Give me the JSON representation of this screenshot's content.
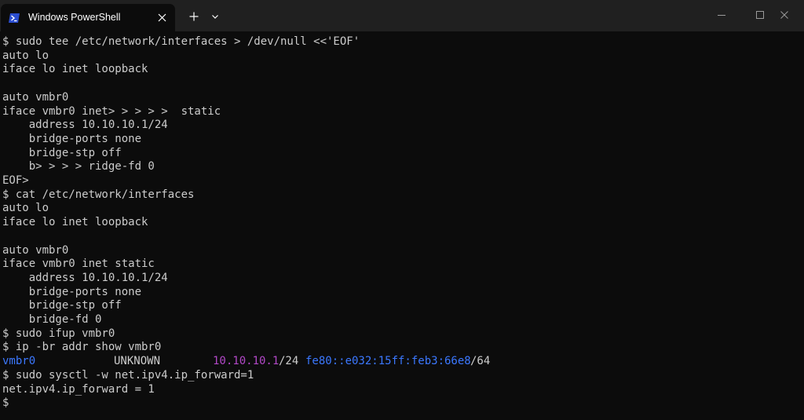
{
  "window": {
    "tab_title": "Windows PowerShell",
    "icons": {
      "tab": "powershell-icon",
      "close_tab": "close-icon",
      "new_tab": "plus-icon",
      "dropdown": "chevron-down-icon",
      "minimize": "minimize-icon",
      "maximize": "maximize-icon",
      "close_window": "close-icon"
    }
  },
  "colors": {
    "background": "#0c0c0c",
    "foreground": "#cccccc",
    "titlebar": "#202020",
    "blue": "#3b78ff",
    "magenta": "#b148c6"
  },
  "terminal": {
    "lines": [
      "$ sudo tee /etc/network/interfaces > /dev/null <<'EOF'",
      "auto lo",
      "iface lo inet loopback",
      "",
      "auto vmbr0",
      "iface vmbr0 inet> > > > >  static",
      "    address 10.10.10.1/24",
      "    bridge-ports none",
      "    bridge-stp off",
      "    b> > > > ridge-fd 0",
      "EOF>",
      "$ cat /etc/network/interfaces",
      "auto lo",
      "iface lo inet loopback",
      "",
      "auto vmbr0",
      "iface vmbr0 inet static",
      "    address 10.10.10.1/24",
      "    bridge-ports none",
      "    bridge-stp off",
      "    bridge-fd 0",
      "$ sudo ifup vmbr0",
      "$ ip -br addr show vmbr0"
    ],
    "addr_row": {
      "iface": "vmbr0",
      "state": "UNKNOWN",
      "ipv4": "10.10.10.1",
      "ipv4_prefix": "/24",
      "ipv6": "fe80::e032:15ff:feb3:66e8",
      "ipv6_prefix": "/64"
    },
    "lines_after": [
      "$ sudo sysctl -w net.ipv4.ip_forward=1",
      "net.ipv4.ip_forward = 1",
      "$"
    ]
  }
}
